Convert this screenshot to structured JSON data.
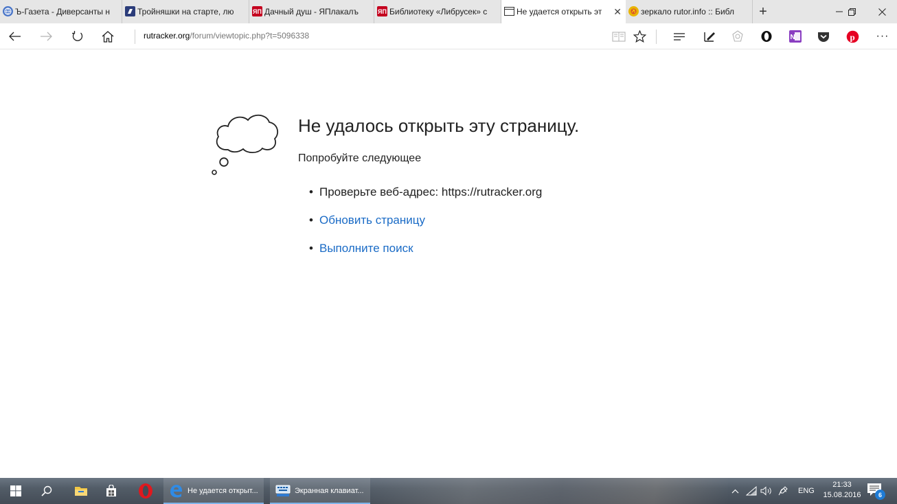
{
  "browser": {
    "tabs": [
      {
        "title": "Ъ-Газета - Диверсанты н",
        "icon": "globe-icon",
        "color": "#4a76c8",
        "glyph": "e"
      },
      {
        "title": "Тройняшки на старте, лю",
        "icon": "site-icon",
        "color": "#2b3c7a",
        "glyph": "🌶"
      },
      {
        "title": "Дачный душ - ЯПлакалъ",
        "icon": "yaplakal-icon",
        "color": "#c4001e",
        "glyph": "ЯП"
      },
      {
        "title": "Библиотеку «Либрусек» с",
        "icon": "yaplakal-icon",
        "color": "#c4001e",
        "glyph": "ЯП"
      },
      {
        "title": "Не удается открыть эт",
        "icon": "page-icon",
        "color": "#ffffff",
        "glyph": ""
      },
      {
        "title": "зеркало rutor.info :: Библ",
        "icon": "rutor-icon",
        "color": "#d9532c",
        "glyph": "☭"
      }
    ],
    "new_tab": "+",
    "window": {
      "minimize": "—",
      "restore": "❐",
      "close": "✕"
    },
    "address": {
      "host": "rutracker.org",
      "path": "/forum/viewtopic.php?t=5096338"
    },
    "more": "···"
  },
  "error": {
    "title": "Не удалось открыть эту страницу.",
    "subtitle": "Попробуйте следующее",
    "items": [
      {
        "text": "Проверьте веб-адрес: https://rutracker.org",
        "link": false
      },
      {
        "text": "Обновить страницу",
        "link": true
      },
      {
        "text": "Выполните поиск",
        "link": true
      }
    ],
    "bullet": "•"
  },
  "taskbar": {
    "apps": [
      {
        "label": "Не удается открыт...",
        "icon": "edge-icon"
      },
      {
        "label": "Экранная клавиат...",
        "icon": "keyboard-icon"
      }
    ],
    "language": "ENG",
    "time": "21:33",
    "date": "15.08.2016",
    "notifications": "6"
  },
  "colors": {
    "link": "#1a6bc6",
    "tabstrip": "#e6e6e6",
    "taskbar_accent": "#7eb4ea"
  }
}
